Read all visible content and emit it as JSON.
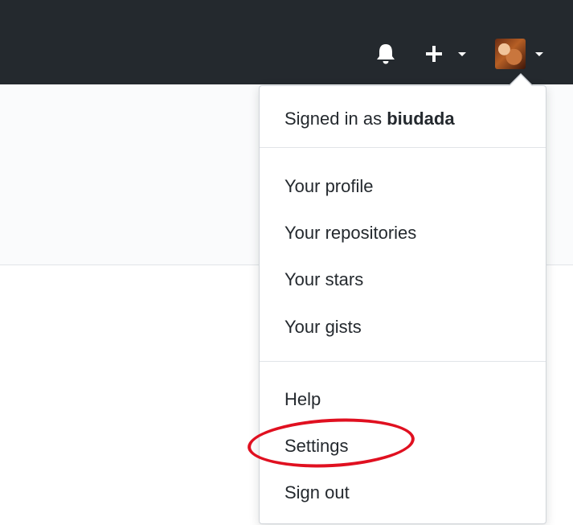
{
  "header": {
    "icons": {
      "notifications": "bell-icon",
      "create_new": "plus-icon",
      "avatar": "user-avatar"
    }
  },
  "dropdown": {
    "signed_in_prefix": "Signed in as",
    "username": "biudada",
    "items": [
      {
        "label": "Your profile"
      },
      {
        "label": "Your repositories"
      },
      {
        "label": "Your stars"
      },
      {
        "label": "Your gists"
      },
      {
        "label": "Help"
      },
      {
        "label": "Settings"
      },
      {
        "label": "Sign out"
      }
    ]
  },
  "annotation": {
    "highlight_color": "#e01020"
  }
}
